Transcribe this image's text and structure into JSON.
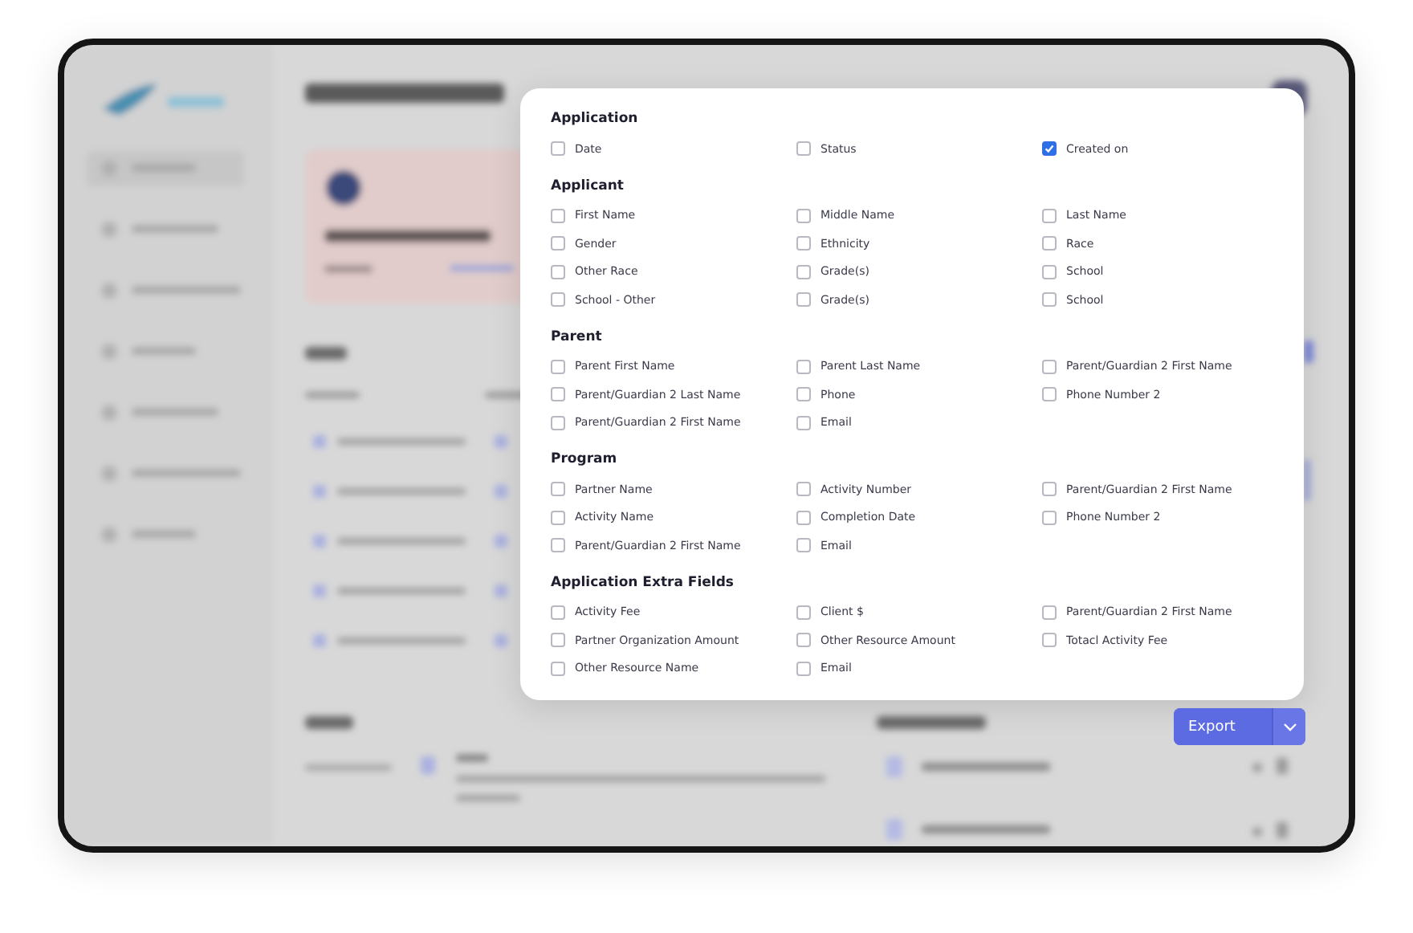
{
  "dialog": {
    "sections": [
      {
        "title": "Application",
        "fields": [
          {
            "label": "Date",
            "checked": false
          },
          {
            "label": "Status",
            "checked": false
          },
          {
            "label": "Created on",
            "checked": true
          }
        ]
      },
      {
        "title": "Applicant",
        "fields": [
          {
            "label": "First Name",
            "checked": false
          },
          {
            "label": "Middle Name",
            "checked": false
          },
          {
            "label": "Last Name",
            "checked": false
          },
          {
            "label": "Gender",
            "checked": false
          },
          {
            "label": "Ethnicity",
            "checked": false
          },
          {
            "label": "Race",
            "checked": false
          },
          {
            "label": "Other Race",
            "checked": false
          },
          {
            "label": "Grade(s)",
            "checked": false
          },
          {
            "label": "School",
            "checked": false
          },
          {
            "label": "School - Other",
            "checked": false
          },
          {
            "label": "Grade(s)",
            "checked": false
          },
          {
            "label": "School",
            "checked": false
          }
        ]
      },
      {
        "title": "Parent",
        "fields": [
          {
            "label": "Parent First Name",
            "checked": false
          },
          {
            "label": "Parent Last Name",
            "checked": false
          },
          {
            "label": "Parent/Guardian 2 First Name",
            "checked": false
          },
          {
            "label": "Parent/Guardian 2 Last Name",
            "checked": false
          },
          {
            "label": "Phone",
            "checked": false
          },
          {
            "label": "Phone Number 2",
            "checked": false
          },
          {
            "label": "Parent/Guardian 2 First Name",
            "checked": false
          },
          {
            "label": "Email",
            "checked": false
          }
        ]
      },
      {
        "title": "Program",
        "fields": [
          {
            "label": "Partner Name",
            "checked": false
          },
          {
            "label": "Activity Number",
            "checked": false
          },
          {
            "label": "Parent/Guardian 2 First Name",
            "checked": false
          },
          {
            "label": "Activity Name",
            "checked": false
          },
          {
            "label": "Completion Date",
            "checked": false
          },
          {
            "label": "Phone Number 2",
            "checked": false
          },
          {
            "label": "Parent/Guardian 2 First Name",
            "checked": false
          },
          {
            "label": "Email",
            "checked": false
          }
        ]
      },
      {
        "title": "Application Extra Fields",
        "fields": [
          {
            "label": "Activity Fee",
            "checked": false
          },
          {
            "label": "Client $",
            "checked": false
          },
          {
            "label": "Parent/Guardian 2 First Name",
            "checked": false
          },
          {
            "label": "Partner Organization Amount",
            "checked": false
          },
          {
            "label": "Other Resource Amount",
            "checked": false
          },
          {
            "label": "Totacl Activity Fee",
            "checked": false
          },
          {
            "label": "Other Resource Name",
            "checked": false
          },
          {
            "label": "Email",
            "checked": false
          }
        ]
      }
    ]
  },
  "export_button": {
    "label": "Export"
  }
}
